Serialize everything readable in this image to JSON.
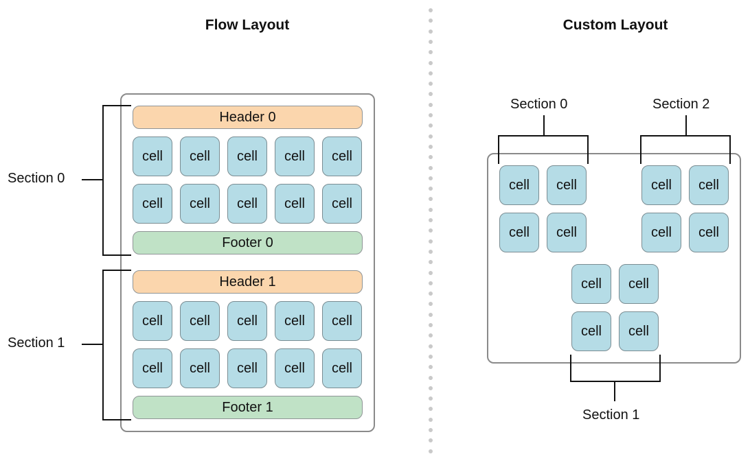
{
  "flow": {
    "title": "Flow Layout",
    "sections": [
      {
        "label": "Section 0",
        "header": "Header 0",
        "footer": "Footer 0"
      },
      {
        "label": "Section 1",
        "header": "Header 1",
        "footer": "Footer 1"
      }
    ],
    "cell_label": "cell"
  },
  "custom": {
    "title": "Custom Layout",
    "sections": [
      {
        "label": "Section 0"
      },
      {
        "label": "Section 1"
      },
      {
        "label": "Section 2"
      }
    ],
    "cell_label": "cell"
  },
  "colors": {
    "cell": "#b5dce6",
    "header": "#fbd6ad",
    "footer": "#c0e2c6",
    "frame": "#8a8a8a",
    "divider": "#c9c9c9"
  }
}
